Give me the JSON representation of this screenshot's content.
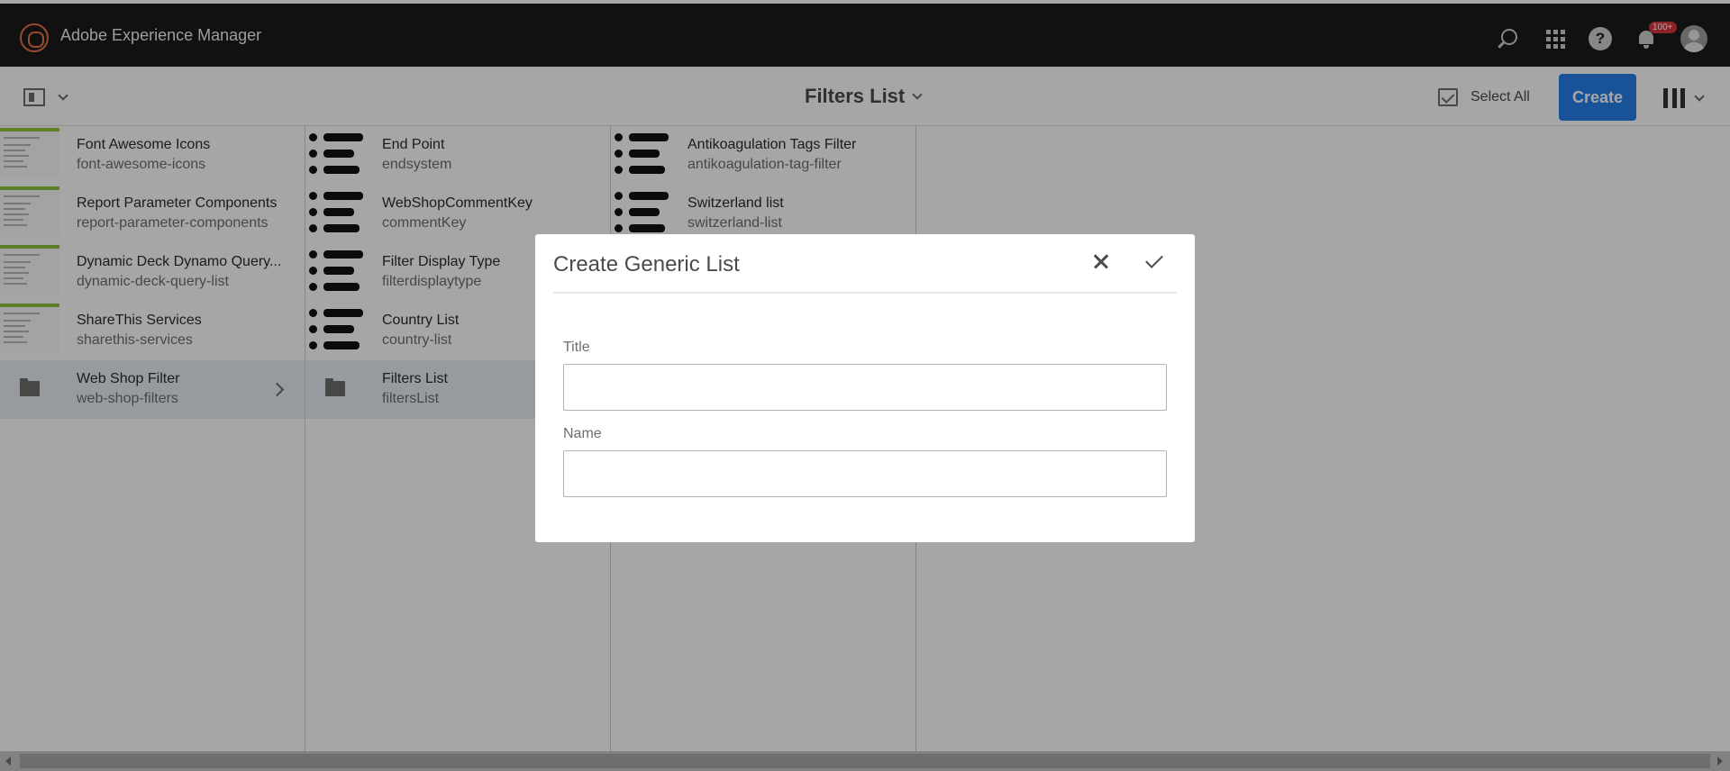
{
  "app": {
    "name": "Adobe Experience Manager",
    "notifications_badge": "100+"
  },
  "header": {
    "title": "Filters List",
    "select_all": "Select All",
    "create": "Create"
  },
  "columns": [
    [
      {
        "title": "Font Awesome Icons",
        "name": "font-awesome-icons",
        "thumb": "page"
      },
      {
        "title": "Report Parameter Components",
        "name": "report-parameter-components",
        "thumb": "page"
      },
      {
        "title": "Dynamic Deck Dynamo Query...",
        "name": "dynamic-deck-query-list",
        "thumb": "page"
      },
      {
        "title": "ShareThis Services",
        "name": "sharethis-services",
        "thumb": "page"
      },
      {
        "title": "Web Shop Filter",
        "name": "web-shop-filters",
        "thumb": "folder",
        "selected": true
      }
    ],
    [
      {
        "title": "End Point",
        "name": "endsystem",
        "thumb": "list"
      },
      {
        "title": "WebShopCommentKey",
        "name": "commentKey",
        "thumb": "list"
      },
      {
        "title": "Filter Display Type",
        "name": "filterdisplaytype",
        "thumb": "list"
      },
      {
        "title": "Country List",
        "name": "country-list",
        "thumb": "list"
      },
      {
        "title": "Filters List",
        "name": "filtersList",
        "thumb": "folder",
        "selected": true
      }
    ],
    [
      {
        "title": "Antikoagulation Tags Filter",
        "name": "antikoagulation-tag-filter",
        "thumb": "list"
      },
      {
        "title": "Switzerland list",
        "name": "switzerland-list",
        "thumb": "list"
      }
    ]
  ],
  "dialog": {
    "title": "Create Generic List",
    "fields": [
      {
        "label": "Title",
        "value": ""
      },
      {
        "label": "Name",
        "value": ""
      }
    ]
  },
  "colors": {
    "accent": "#2680eb",
    "topbar": "#1b1b1b",
    "thumb_bar": "#8fc43c"
  }
}
